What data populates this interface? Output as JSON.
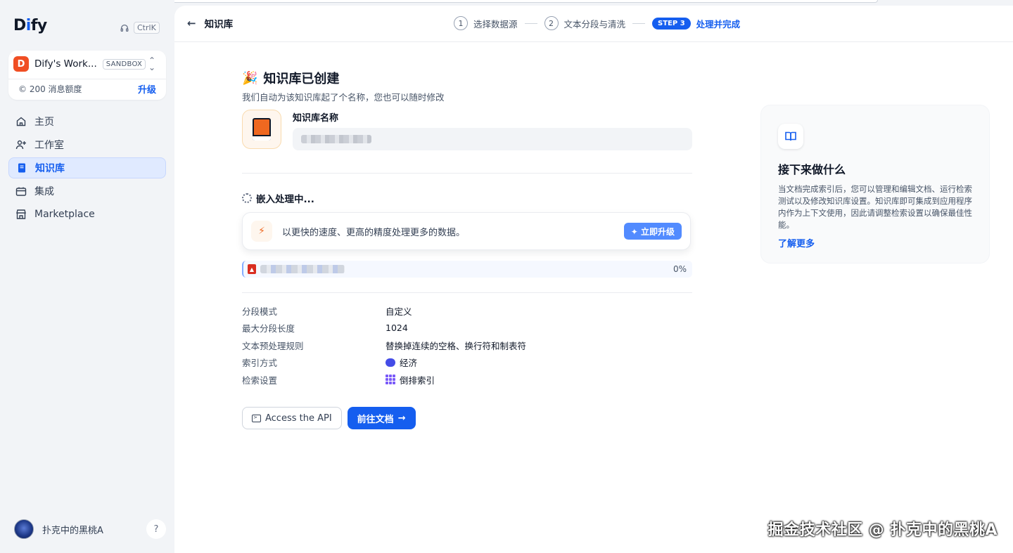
{
  "app": {
    "logo_prefix": "D",
    "logo_i": "i",
    "logo_suffix": "fy"
  },
  "search": {
    "shortcut": "CtrlK"
  },
  "workspace": {
    "avatar_letter": "D",
    "name": "Dify's Work...",
    "plan_badge": "SANDBOX",
    "quota_text": "© 200 消息额度",
    "upgrade_label": "升级"
  },
  "nav": {
    "items": [
      {
        "label": "主页",
        "icon": "home-icon"
      },
      {
        "label": "工作室",
        "icon": "studio-icon"
      },
      {
        "label": "知识库",
        "icon": "knowledge-icon",
        "active": true
      },
      {
        "label": "集成",
        "icon": "tools-icon"
      },
      {
        "label": "Marketplace",
        "icon": "marketplace-icon"
      }
    ]
  },
  "user": {
    "name": "扑克中的黑桃A",
    "help_label": "?"
  },
  "topbar": {
    "back_label": "知识库",
    "steps": [
      {
        "num": "1",
        "label": "选择数据源"
      },
      {
        "num": "2",
        "label": "文本分段与清洗"
      },
      {
        "num": "STEP 3",
        "label": "处理并完成"
      }
    ]
  },
  "created": {
    "emoji": "🎉",
    "title": "知识库已创建",
    "subtitle": "我们自动为该知识库起了个名称，您也可以随时修改",
    "name_label": "知识库名称"
  },
  "embedding": {
    "title": "嵌入处理中...",
    "upsell_text": "以更快的速度、更高的精度处理更多的数据。",
    "upsell_button": "✦ 立即升级",
    "file_percent": "0%"
  },
  "settings": {
    "rows": [
      {
        "key": "分段模式",
        "value": "自定义"
      },
      {
        "key": "最大分段长度",
        "value": "1024"
      },
      {
        "key": "文本预处理规则",
        "value": "替换掉连续的空格、换行符和制表符"
      },
      {
        "key": "索引方式",
        "value": "经济"
      },
      {
        "key": "检索设置",
        "value": "倒排索引"
      }
    ]
  },
  "actions": {
    "api_label": "Access the API",
    "docs_label": "前往文档"
  },
  "next": {
    "title": "接下来做什么",
    "description": "当文档完成索引后，您可以管理和编辑文档、运行检索测试以及修改知识库设置。知识库即可集成到应用程序内作为上下文使用，因此请调整检索设置以确保最佳性能。",
    "link": "了解更多"
  },
  "watermark": "掘金技术社区 @ 扑克中的黑桃A",
  "colors": {
    "accent": "#155eef",
    "workspace_avatar": "#f04e23",
    "book": "#ef6820"
  }
}
